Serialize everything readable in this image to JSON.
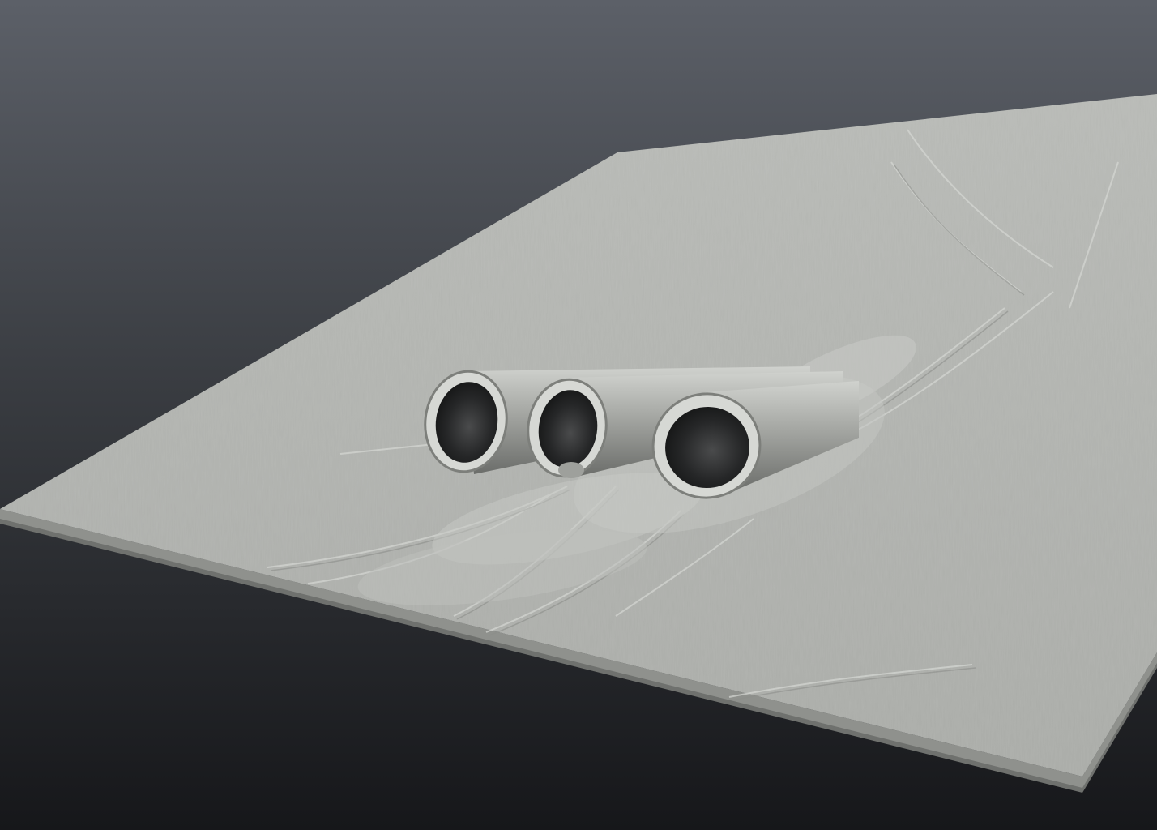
{
  "viewport": {
    "gradient_top": "#5c6068",
    "gradient_bottom": "#16171a"
  },
  "model": {
    "slab_color": "#b3b5b1",
    "slab_edge_color": "#8f918d",
    "slab_shadow_color": "#6f716e",
    "pipe_color": "#9fa19e",
    "pipe_highlight": "#d9dbd7",
    "pipe_interior": "#2a2b2c",
    "pipe_count": 3
  }
}
